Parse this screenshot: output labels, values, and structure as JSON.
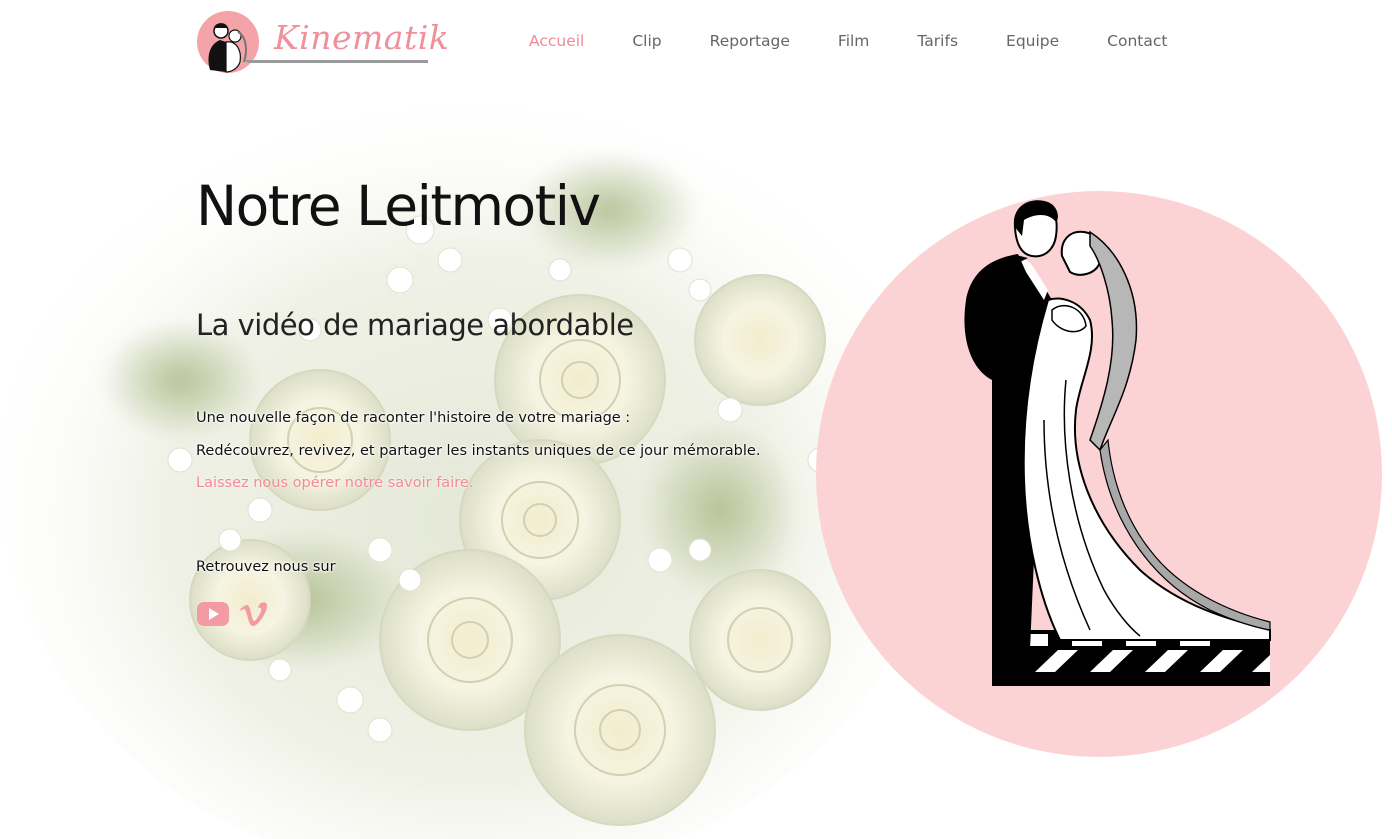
{
  "brand": {
    "name": "Kinematik",
    "accent_color": "#f0909a",
    "logo_icon": "wedding-couple-logo"
  },
  "nav": {
    "items": [
      {
        "label": "Accueil",
        "active": true
      },
      {
        "label": "Clip",
        "active": false
      },
      {
        "label": "Reportage",
        "active": false
      },
      {
        "label": "Film",
        "active": false
      },
      {
        "label": "Tarifs",
        "active": false
      },
      {
        "label": "Equipe",
        "active": false
      },
      {
        "label": "Contact",
        "active": false
      }
    ],
    "active_color": "#ef8a96",
    "text_color": "#666666"
  },
  "hero": {
    "title": "Notre Leitmotiv",
    "subtitle": "La vidéo de mariage abordable",
    "line1": "Une nouvelle façon de raconter l'histoire de votre mariage :",
    "line2": "Redécouvrez, revivez, et partager les instants uniques de ce jour mémorable.",
    "highlight": "Laissez nous opérer notre savoir faire.",
    "follow_label": "Retrouvez nous sur",
    "socials": [
      {
        "icon": "youtube-icon"
      },
      {
        "icon": "vimeo-icon"
      }
    ]
  },
  "illustration": {
    "circle_color": "#fcd3d5",
    "icon": "wedding-couple-clapperboard"
  }
}
